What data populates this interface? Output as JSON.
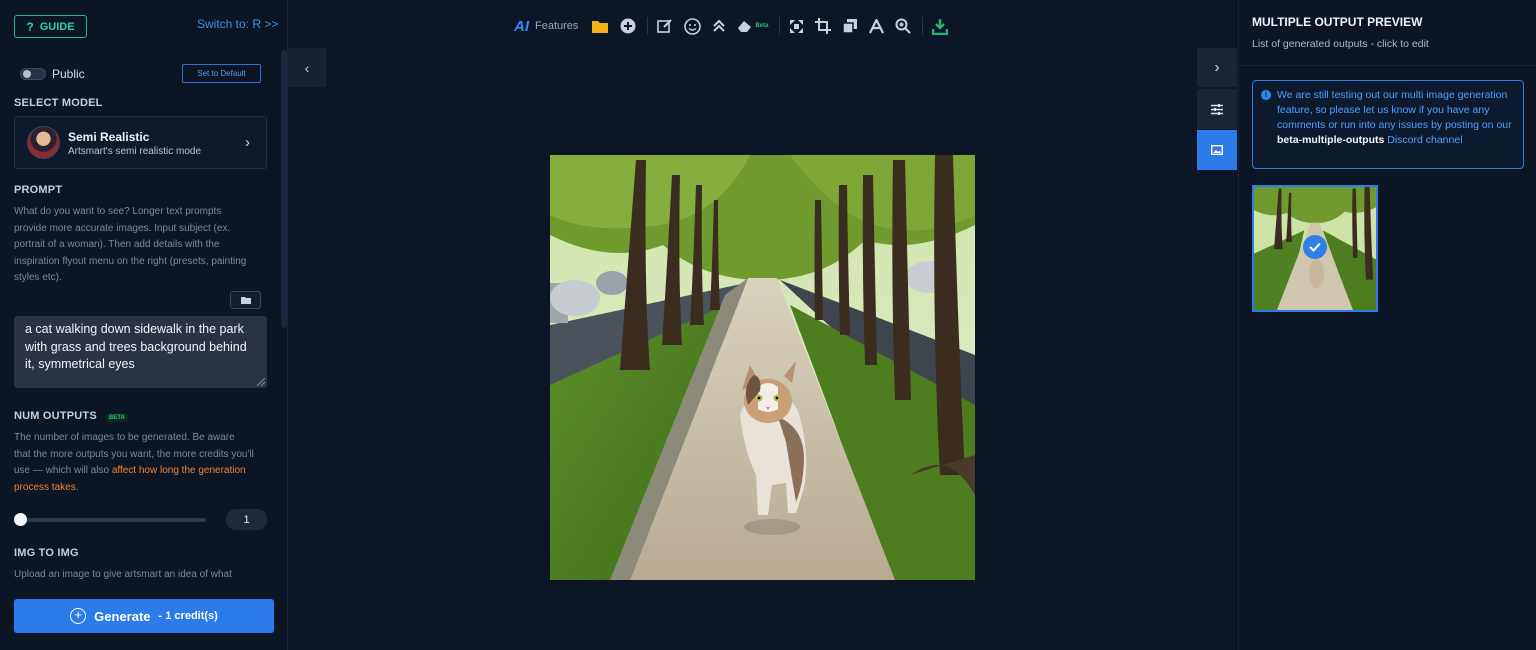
{
  "left_panel": {
    "guide_label": "GUIDE",
    "switch_link": "Switch to: R >>",
    "public_label": "Public",
    "set_default_label": "Set to Default",
    "select_model_title": "SELECT MODEL",
    "model": {
      "name": "Semi Realistic",
      "description": "Artsmart's semi realistic mode"
    },
    "prompt_title": "PROMPT",
    "prompt_help": "What do you want to see? Longer text prompts provide more accurate images. Input subject (ex. portrait of a woman). Then add details with the inspiration flyout menu on the right (presets, painting styles etc).",
    "prompt_value": "a cat walking down sidewalk in the park with grass and trees background behind it, symmetrical eyes",
    "num_outputs_title": "NUM OUTPUTS",
    "num_outputs_badge": "BETA",
    "num_outputs_help": "The number of images to be generated. Be aware that the more outputs you want, the more credits you'll use — which will also ",
    "num_outputs_warning": "affect how long the generation process takes.",
    "num_outputs_value": "1",
    "img_to_img_title": "IMG TO IMG",
    "img_to_img_help": "Upload an image to give artsmart an idea of what",
    "generate_label": "Generate",
    "generate_credits": "- 1 credit(s)"
  },
  "toolbar": {
    "ai_label": "AI",
    "features_label": "Features",
    "beta_label": "Beta",
    "icons": [
      "folder-icon",
      "add-icon",
      "edit-icon",
      "face-icon",
      "upscale-icon",
      "eraser-icon",
      "expand-icon",
      "crop-icon",
      "layers-icon",
      "text-icon",
      "zoom-icon",
      "download-icon"
    ]
  },
  "right_panel": {
    "title": "MULTIPLE OUTPUT PREVIEW",
    "subtitle": "List of generated outputs - click to edit",
    "info_prefix": "We are still testing out our multi image generation feature, so please let us know if you have any comments or run into any issues by posting on our ",
    "info_channel": "beta-multiple-outputs",
    "info_suffix": " Discord channel"
  },
  "colors": {
    "accent": "#2c7bea",
    "guide": "#29d1a3",
    "warning": "#f08432",
    "background": "#0c1626"
  }
}
